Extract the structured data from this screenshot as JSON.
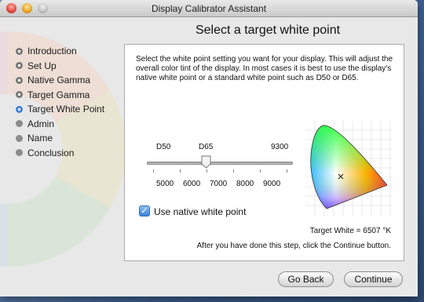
{
  "window": {
    "title": "Display Calibrator Assistant",
    "page_title": "Select a target white point"
  },
  "steps": [
    {
      "label": "Introduction",
      "state": "done"
    },
    {
      "label": "Set Up",
      "state": "done"
    },
    {
      "label": "Native Gamma",
      "state": "done"
    },
    {
      "label": "Target Gamma",
      "state": "done"
    },
    {
      "label": "Target White Point",
      "state": "current"
    },
    {
      "label": "Admin",
      "state": "todo"
    },
    {
      "label": "Name",
      "state": "todo"
    },
    {
      "label": "Conclusion",
      "state": "todo"
    }
  ],
  "main": {
    "description": "Select the white point setting you want for your display.  This will adjust the overall color tint of the display.  In most cases it is best to use the display's native white point or a standard white point such as D50 or D65.",
    "slider": {
      "presets": [
        "D50",
        "D65",
        "9300"
      ],
      "scale_labels": [
        "5000",
        "6000",
        "7000",
        "8000",
        "9000"
      ],
      "value_kelvin": 6507
    },
    "native_checkbox": {
      "label": "Use native white point",
      "checked": true
    },
    "target_white": "Target White = 6507 °K",
    "after_text": "After you have done this step, click the Continue button."
  },
  "buttons": {
    "go_back": "Go Back",
    "continue": "Continue"
  },
  "icons": {
    "close": "close-traffic-light-icon",
    "minimize": "minimize-traffic-light-icon",
    "zoom": "zoom-traffic-light-icon",
    "chromaticity_chart": "chromaticity-diagram"
  }
}
